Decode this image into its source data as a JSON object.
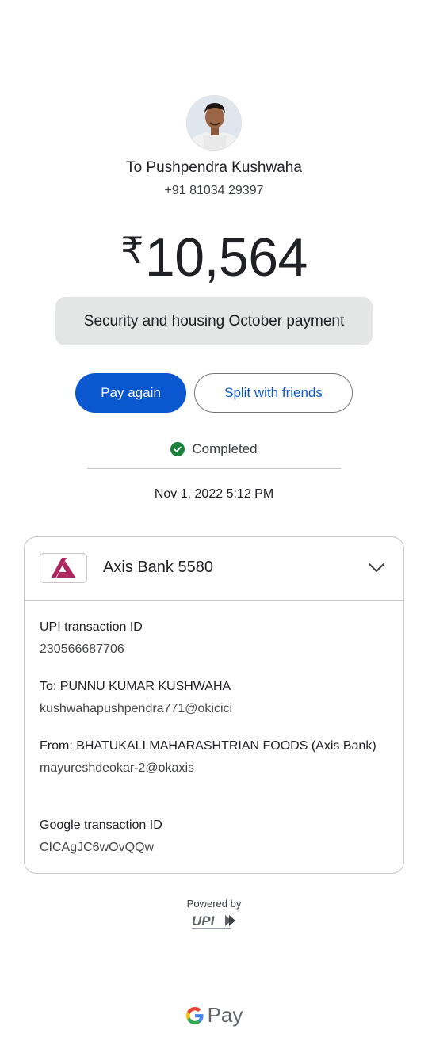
{
  "recipient": {
    "name": "To Pushpendra Kushwaha",
    "phone": "+91 81034 29397"
  },
  "payment": {
    "currency_symbol": "₹",
    "amount": "10,564",
    "note": "Security and housing October payment"
  },
  "actions": {
    "pay_again": "Pay again",
    "split": "Split with friends"
  },
  "status": {
    "text": "Completed",
    "datetime": "Nov 1, 2022 5:12 PM"
  },
  "account": {
    "bank_name": "Axis Bank 5580"
  },
  "details": [
    {
      "label": "UPI transaction ID",
      "value": "230566687706"
    },
    {
      "label": "To: PUNNU KUMAR KUSHWAHA",
      "value": "kushwahapushpendra771@okicici"
    },
    {
      "label": "From: BHATUKALI MAHARASHTRIAN FOODS (Axis Bank)",
      "value": "mayureshdeokar-2@okaxis"
    },
    {
      "label": "Google transaction ID",
      "value": "CICAgJC6wOvQQw"
    }
  ],
  "footer": {
    "powered_by": "Powered by",
    "brand": "Pay"
  },
  "colors": {
    "primary": "#0b57d0",
    "success": "#188038",
    "axis": "#ae275f"
  },
  "icons": [
    "avatar",
    "check-icon",
    "axis-bank-logo",
    "chevron-down-icon",
    "upi-logo",
    "google-g-logo"
  ]
}
